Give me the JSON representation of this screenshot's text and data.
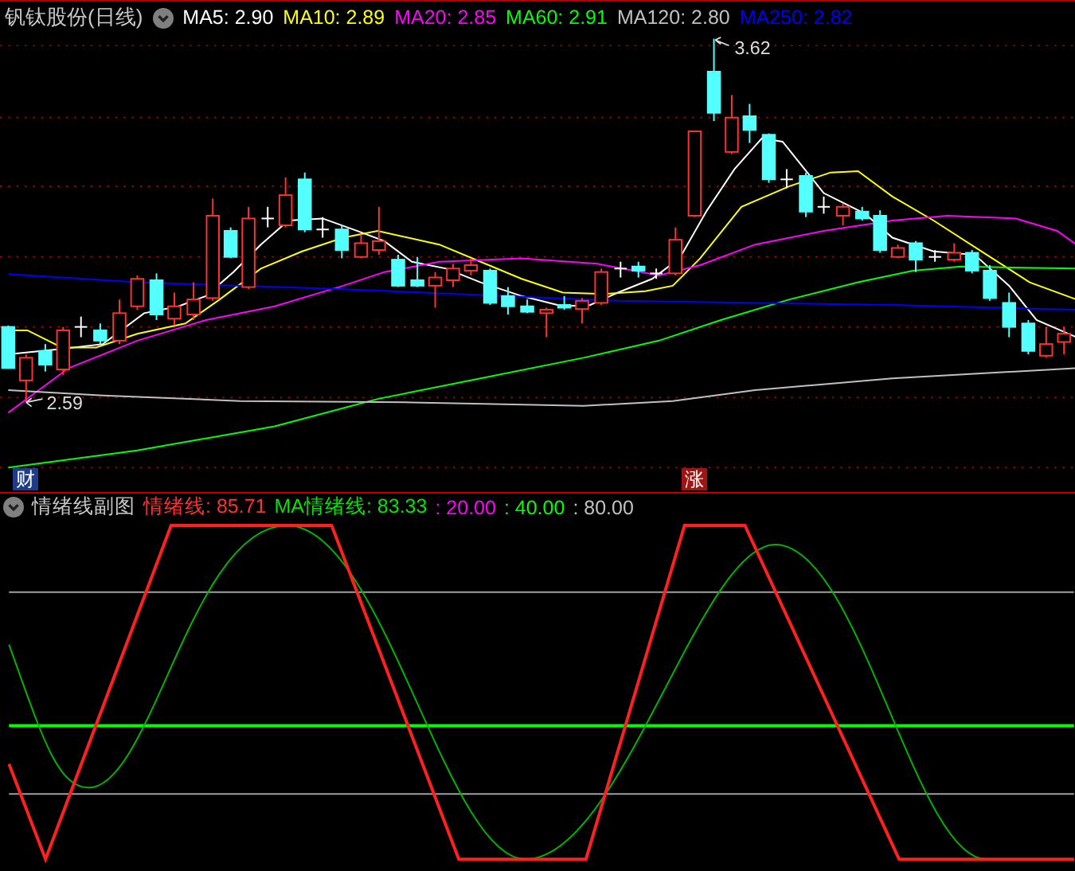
{
  "header": {
    "title": "钒钛股份(日线)",
    "indicators": [
      {
        "label": "MA5: 2.90",
        "color": "#ffffff"
      },
      {
        "label": "MA10: 2.89",
        "color": "#ffff00"
      },
      {
        "label": "MA20: 2.85",
        "color": "#ff00ff"
      },
      {
        "label": "MA60: 2.91",
        "color": "#00ff00"
      },
      {
        "label": "MA120: 2.80",
        "color": "#c0c0c0"
      },
      {
        "label": "MA250: 2.82",
        "color": "#0000ff"
      }
    ]
  },
  "main_chart": {
    "high_label": "3.62",
    "low_label": "2.59",
    "markers": [
      {
        "label": "财",
        "kind": "finance"
      },
      {
        "label": "涨",
        "kind": "rise"
      }
    ]
  },
  "sub_chart": {
    "title": "情绪线副图",
    "indicators": [
      {
        "label": "情绪线: 85.71",
        "color": "#ff3232"
      },
      {
        "label": "MA情绪线: 83.33",
        "color": "#00e600"
      },
      {
        "label": ": 20.00",
        "color": "#ff00ff"
      },
      {
        "label": ": 40.00",
        "color": "#00ff00"
      },
      {
        "label": ": 80.00",
        "color": "#c0c0c0"
      }
    ]
  }
}
